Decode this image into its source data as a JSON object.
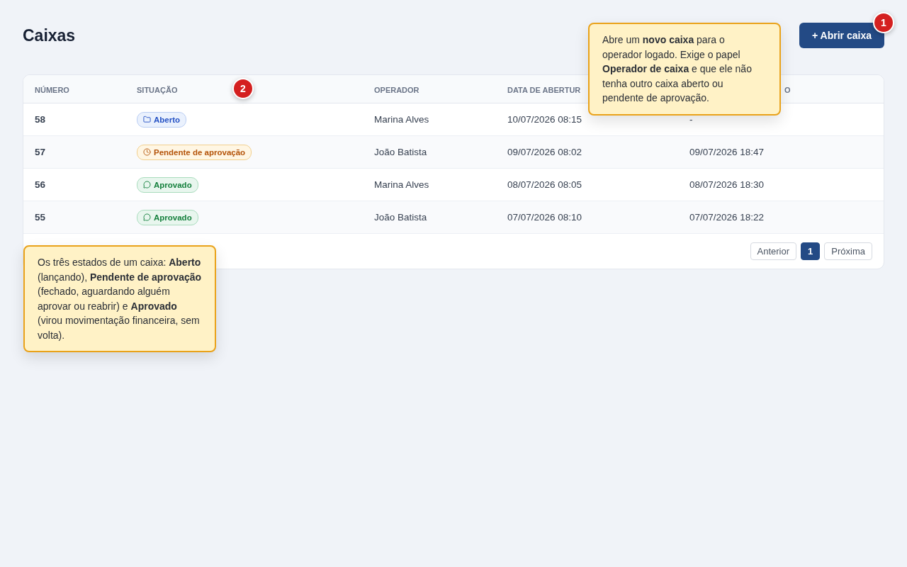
{
  "title": "Caixas",
  "primary_button": {
    "label": "+ Abrir caixa"
  },
  "table": {
    "columns": [
      "NÚMERO",
      "SITUAÇÃO",
      "OPERADOR",
      "DATA DE ABERTUR",
      "O"
    ],
    "rows": [
      {
        "number": "58",
        "status": {
          "kind": "open",
          "label": "Aberto"
        },
        "operator": "Marina Alves",
        "opened": "10/07/2026 08:15",
        "column_5": "-"
      },
      {
        "number": "57",
        "status": {
          "kind": "pending",
          "label": "Pendente de aprovação"
        },
        "operator": "João Batista",
        "opened": "09/07/2026 08:02",
        "column_5": "09/07/2026 18:47"
      },
      {
        "number": "56",
        "status": {
          "kind": "approved",
          "label": "Aprovado"
        },
        "operator": "Marina Alves",
        "opened": "08/07/2026 08:05",
        "column_5": "08/07/2026 18:30"
      },
      {
        "number": "55",
        "status": {
          "kind": "approved",
          "label": "Aprovado"
        },
        "operator": "João Batista",
        "opened": "07/07/2026 08:10",
        "column_5": "07/07/2026 18:22"
      }
    ]
  },
  "pagination": [
    {
      "label": "Anterior",
      "selected": false
    },
    {
      "label": "1",
      "selected": true
    },
    {
      "label": "Próxima",
      "selected": false
    }
  ],
  "callouts": [
    {
      "number": "1",
      "text": "Abre um **novo caixa** para o operador logado. Exige o papel **Operador de caixa** e que ele não tenha outro caixa aberto ou pendente de aprovação."
    },
    {
      "number": "2",
      "text": "Os três estados de um caixa: **Aberto** (lançando), **Pendente de aprovação** (fechado, aguardando alguém aprovar ou reabrir) e **Aprovado** (virou movimentação financeira, sem volta)."
    }
  ]
}
